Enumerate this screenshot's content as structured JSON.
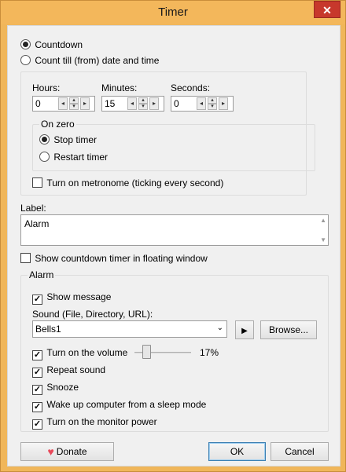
{
  "window": {
    "title": "Timer",
    "close_glyph": "✕"
  },
  "mode": {
    "countdown": {
      "label": "Countdown",
      "selected": true
    },
    "count_till": {
      "label": "Count till (from) date and time",
      "selected": false
    }
  },
  "time": {
    "hours_label": "Hours:",
    "hours_value": "0",
    "minutes_label": "Minutes:",
    "minutes_value": "15",
    "seconds_label": "Seconds:",
    "seconds_value": "0"
  },
  "on_zero": {
    "title": "On zero",
    "stop_timer": {
      "label": "Stop timer",
      "selected": true
    },
    "restart_timer": {
      "label": "Restart timer",
      "selected": false
    }
  },
  "metronome": {
    "label": "Turn on metronome (ticking every second)",
    "checked": false
  },
  "label_field": {
    "caption": "Label:",
    "value": "Alarm"
  },
  "floating": {
    "label": "Show countdown timer in floating window",
    "checked": false
  },
  "alarm": {
    "title": "Alarm",
    "show_message": {
      "label": "Show message",
      "checked": true
    },
    "sound_caption": "Sound (File, Directory, URL):",
    "sound_value": "Bells1",
    "play_glyph": "▶",
    "browse_label": "Browse...",
    "volume": {
      "label": "Turn on the volume",
      "checked": true,
      "percent_text": "17%",
      "level": 0.17
    },
    "repeat_sound": {
      "label": "Repeat sound",
      "checked": true
    },
    "snooze": {
      "label": "Snooze",
      "checked": true
    },
    "wake_up": {
      "label": "Wake up computer from a sleep mode",
      "checked": true
    },
    "monitor_power": {
      "label": "Turn on the monitor power",
      "checked": true
    }
  },
  "footer": {
    "donate_label": "Donate",
    "ok_label": "OK",
    "cancel_label": "Cancel"
  },
  "icons": {
    "heart": "heart-icon",
    "play": "play-icon",
    "close": "close-icon"
  },
  "colors": {
    "titlebar": "#f3b75b",
    "close": "#c7382c",
    "default_button": "#3c7fb1"
  }
}
